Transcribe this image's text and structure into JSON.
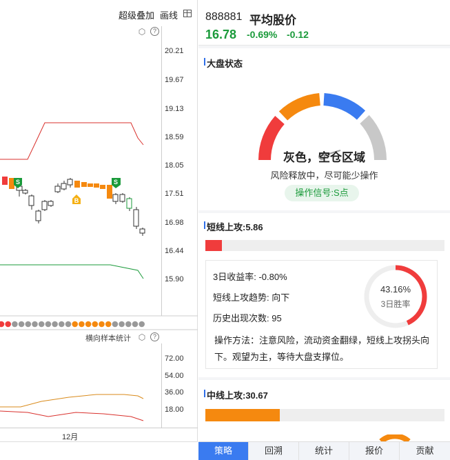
{
  "toolbar": {
    "overlay_label": "超级叠加",
    "draw_label": "画线"
  },
  "price_axis": [
    "20.21",
    "19.67",
    "19.13",
    "18.59",
    "18.05",
    "17.51",
    "16.98",
    "16.44",
    "15.90"
  ],
  "sub_panel": {
    "title": "横向样本统计",
    "ticks": [
      "72.00",
      "54.00",
      "36.00",
      "18.00"
    ]
  },
  "date_label": "12月",
  "signals": {
    "s1": "S",
    "b1": "B",
    "s2": "S"
  },
  "header": {
    "code": "888881",
    "name": "平均股价",
    "price": "16.78",
    "pct": "-0.69%",
    "change": "-0.12"
  },
  "market": {
    "title": "大盘状态",
    "state": "灰色，空仓区域",
    "desc": "风险释放中，尽可能少操作",
    "signal": "操作信号:S点"
  },
  "short": {
    "title": "短线上攻:5.86",
    "bar_fraction": 0.07,
    "return_3d": "3日收益率:  -0.80%",
    "trend": "短线上攻趋势:  向下",
    "count": "历史出现次数:  95",
    "method": "操作方法：注意风险，流动资金翻绿，短线上攻拐头向下。观望为主，等待大盘支撑位。",
    "win_pct": "43.16%",
    "win_label": "3日胜率",
    "win_fraction": 0.4316
  },
  "mid": {
    "title": "中线上攻:30.67",
    "bar_fraction": 0.31
  },
  "tabs": [
    "策略",
    "回溯",
    "统计",
    "报价",
    "贡献"
  ],
  "colors": {
    "red": "#f03c3c",
    "orange": "#f5890f",
    "blue": "#3a7bf0",
    "gray": "#c8c8c8",
    "green": "#1a9a3a"
  }
}
